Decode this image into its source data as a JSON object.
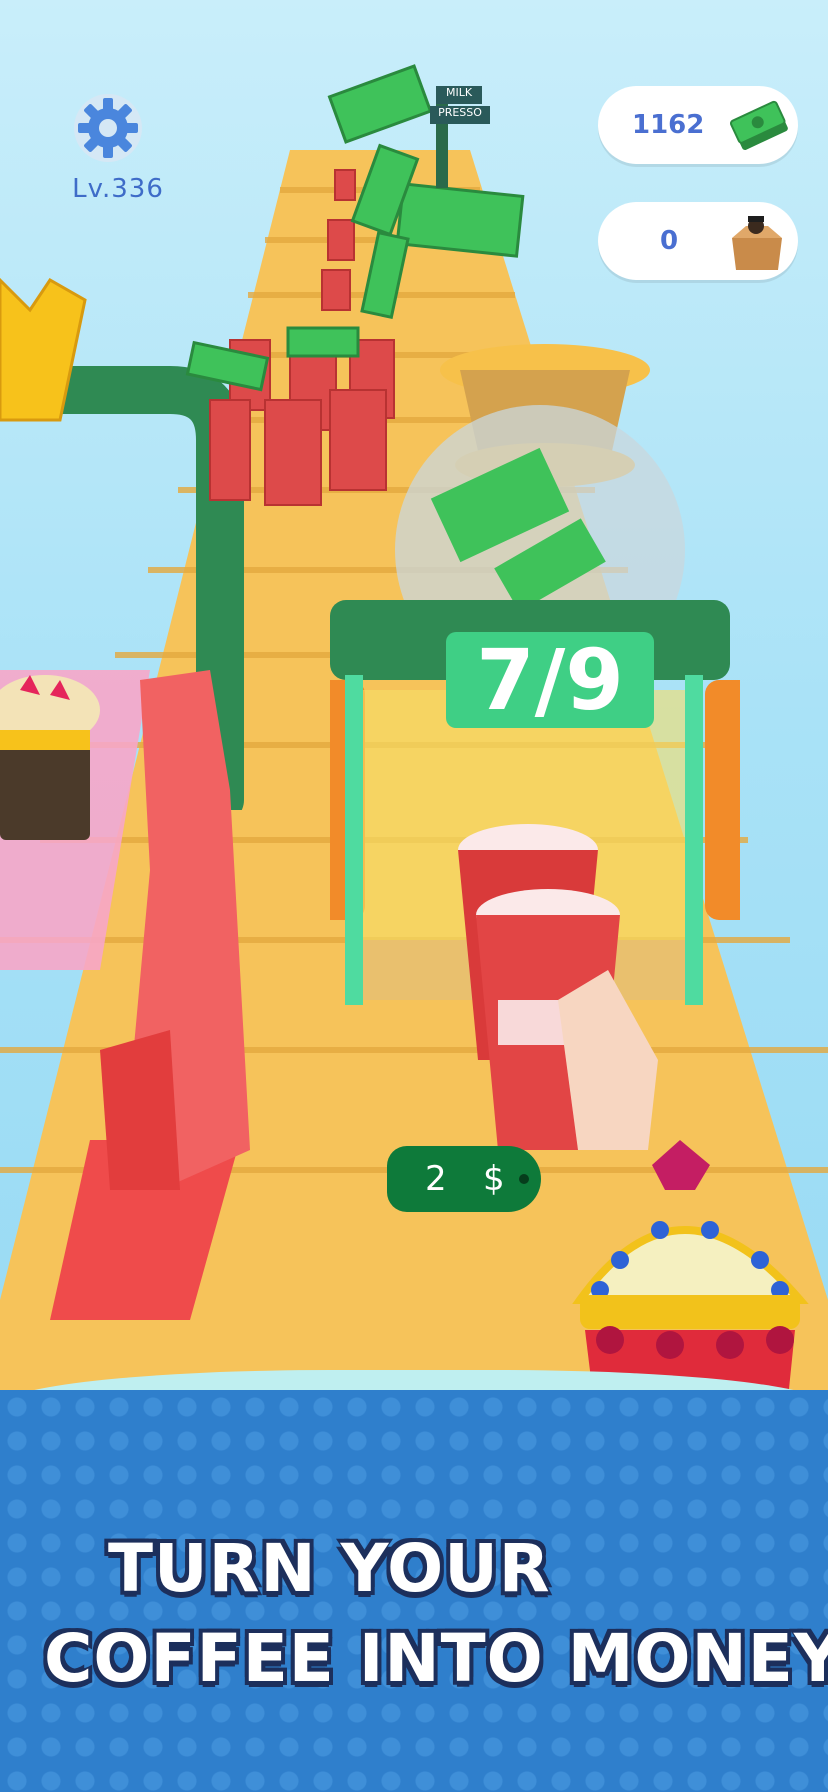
{
  "hud": {
    "level": "Lv.336",
    "cash": "1162",
    "boxes": "0",
    "settings_icon": "gear-icon",
    "cash_icon": "cash-stack-icon",
    "box_icon": "box-icon"
  },
  "world": {
    "signpost": {
      "line1": "MILK",
      "line2": "PRESSO"
    },
    "gate": {
      "progress": "7/9",
      "current": 7,
      "total": 9
    },
    "price_tag": {
      "amount": "2",
      "currency": "$"
    }
  },
  "promo": {
    "line1": "TURN YOUR",
    "line2": "COFFEE INTO MONEY"
  },
  "colors": {
    "stairs": "#f6c35a",
    "gate": "#3fcf85",
    "cup": "#d93a3a",
    "cash": "#3fc25a",
    "accent_blue": "#4a6fd1"
  }
}
